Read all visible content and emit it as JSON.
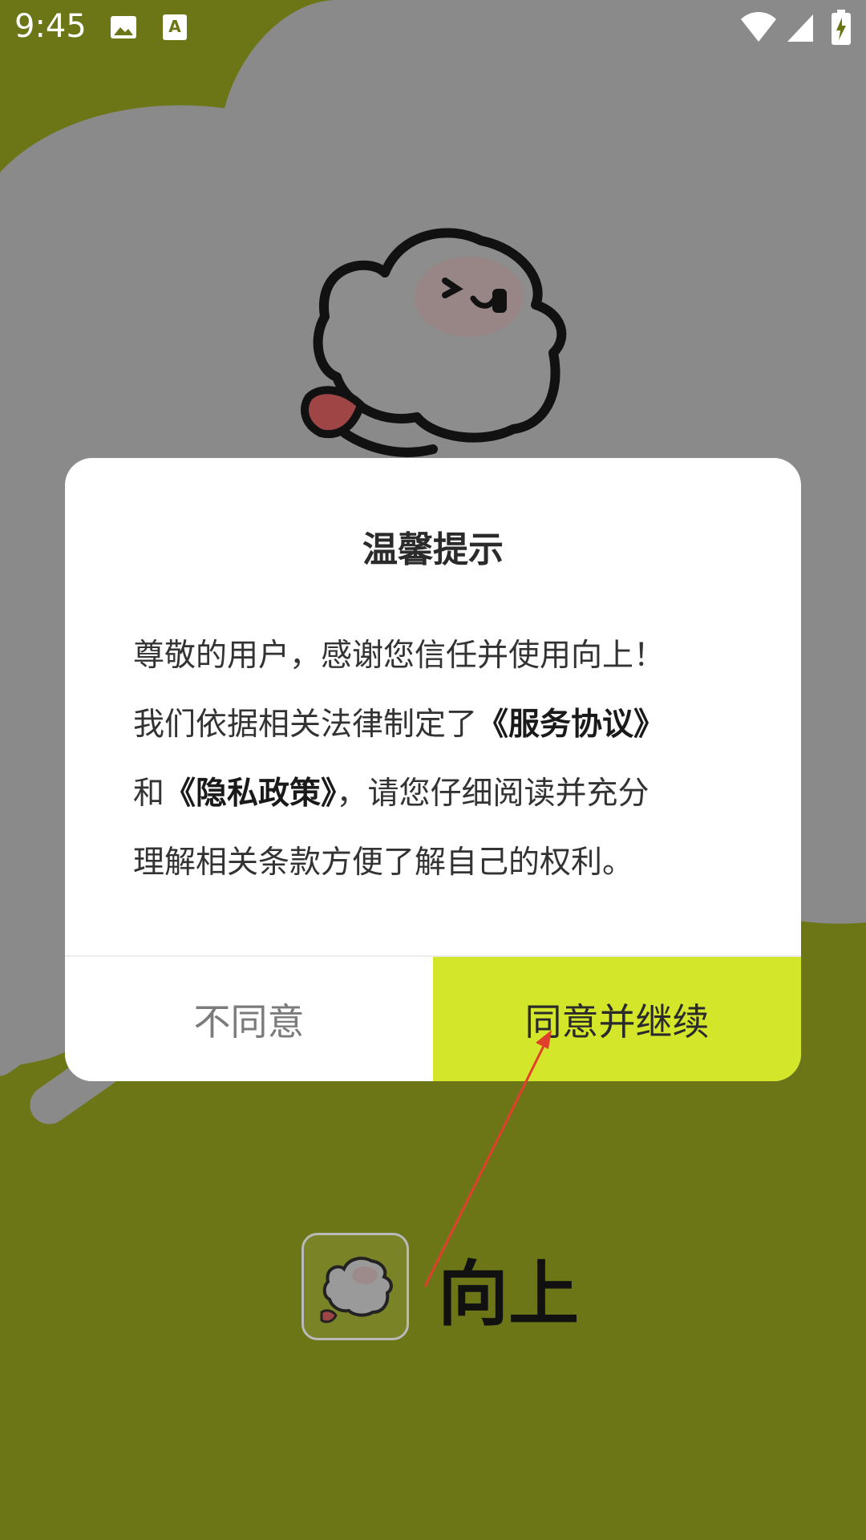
{
  "status_bar": {
    "time": "9:45",
    "icons": [
      "image-icon",
      "text-accessibility-icon",
      "wifi-icon",
      "signal-icon",
      "battery-charging-icon"
    ]
  },
  "dialog": {
    "title": "温馨提示",
    "body": {
      "line1": "尊敬的用户，感谢您信任并使用向上！",
      "line2_prefix": "我们依据相关法律制定了",
      "terms_link": "《服务协议》",
      "line3_prefix": "和",
      "privacy_link": "《隐私政策》",
      "line3_suffix": "，请您仔细阅读并充分",
      "line4": "理解相关条款方便了解自己的权利。"
    },
    "disagree_label": "不同意",
    "agree_label": "同意并继续"
  },
  "brand": {
    "name": "向上",
    "logo": "mascot-logo-icon"
  },
  "colors": {
    "background": "#6d7617",
    "overlay_shape": "#8a8a8a",
    "accent_button": "#d4e629",
    "annotation_arrow": "#e0402b"
  }
}
